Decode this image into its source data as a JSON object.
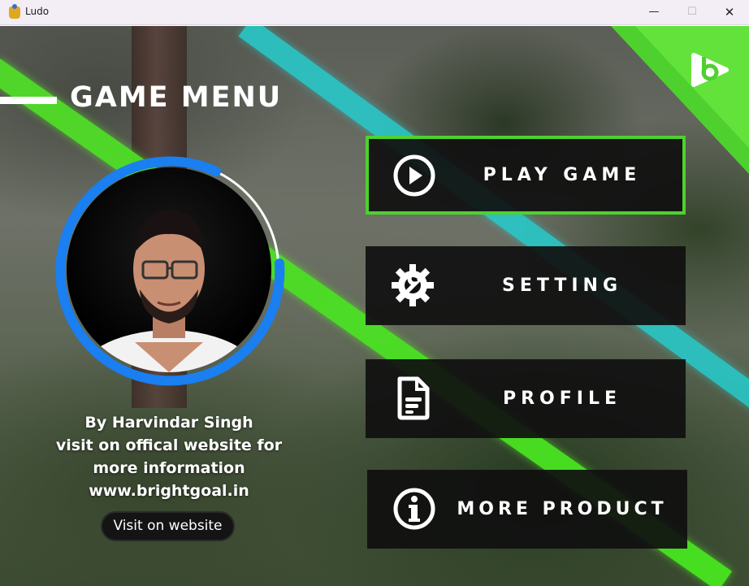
{
  "window": {
    "title": "Ludo",
    "minimize_glyph": "—",
    "maximize_glyph": "☐",
    "close_glyph": "✕"
  },
  "menu": {
    "heading": "GAME MENU",
    "buttons": [
      {
        "label": "PLAY GAME",
        "icon": "play-circle-icon",
        "active": true
      },
      {
        "label": "SETTING",
        "icon": "gear-wrench-icon",
        "active": false
      },
      {
        "label": "PROFILE",
        "icon": "document-icon",
        "active": false
      },
      {
        "label": "MORE PRODUCT",
        "icon": "info-circle-icon",
        "active": false
      }
    ]
  },
  "credits": {
    "line1": "By Harvindar Singh",
    "line2": "visit on offical website for",
    "line3": "more information",
    "line4": "www.brightgoal.in",
    "visit_button": "Visit on website"
  },
  "colors": {
    "accent_green": "#4ed12e",
    "ring_blue": "#1a7ff0",
    "button_bg": "#101010",
    "stripe_cyan": "#28c8c8"
  }
}
